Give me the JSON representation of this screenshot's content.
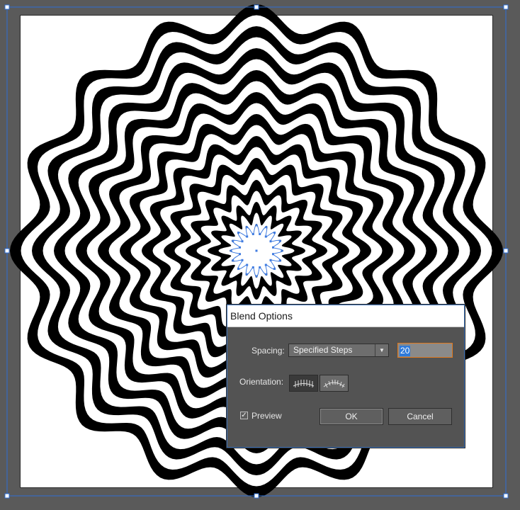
{
  "dialog": {
    "title": "Blend Options",
    "spacing_label": "Spacing:",
    "spacing_value": "Specified Steps",
    "steps_value": "20",
    "orientation_label": "Orientation:",
    "preview_label": "Preview",
    "preview_checked": true,
    "ok_label": "OK",
    "cancel_label": "Cancel"
  },
  "icons": {
    "orient_align_page": "align-to-page-icon",
    "orient_align_path": "align-to-path-icon",
    "dropdown": "chevron-down-icon",
    "check": "checkmark-icon"
  },
  "colors": {
    "canvas": "#5a5a5a",
    "artboard": "#ffffff",
    "selection": "#2e6fd6",
    "dialog_bg": "#535353",
    "focus": "#e07a1f"
  }
}
